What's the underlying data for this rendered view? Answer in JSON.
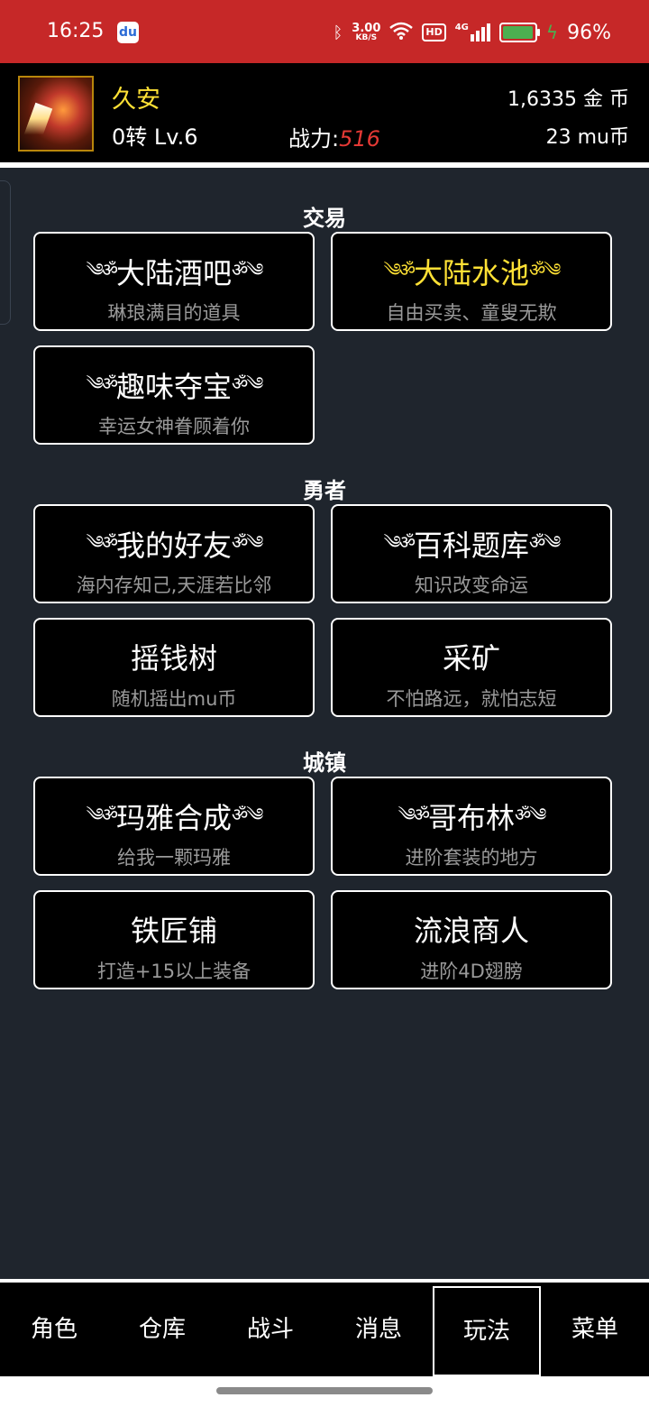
{
  "status_bar": {
    "time": "16:25",
    "app_icon": "baidu-icon",
    "speed_value": "3.00",
    "speed_unit": "KB/S",
    "hd_label": "HD",
    "network_label": "4G",
    "battery_percent": "96%",
    "battery_level": 0.96,
    "icons": [
      "bluetooth-icon",
      "wifi-icon",
      "signal-icon",
      "battery-icon",
      "charging-icon"
    ]
  },
  "header": {
    "player_name": "久安",
    "player_level": "0转 Lv.6",
    "power_label": "战力:",
    "power_value": "516",
    "gold": "1,6335 金 币",
    "mu_coins": "23 mu币",
    "colors": {
      "name": "#ffe135",
      "power_value": "#e53935"
    }
  },
  "ornaments": {
    "left": "༄ॐ",
    "right": "ॐ༄"
  },
  "sections": [
    {
      "title": "交易",
      "cards": [
        {
          "title": "大陆酒吧",
          "subtitle": "琳琅满目的道具",
          "ornate": true,
          "highlight": false
        },
        {
          "title": "大陆水池",
          "subtitle": "自由买卖、童叟无欺",
          "ornate": true,
          "highlight": true
        },
        {
          "title": "趣味夺宝",
          "subtitle": "幸运女神眷顾着你",
          "ornate": true,
          "highlight": false
        }
      ]
    },
    {
      "title": "勇者",
      "cards": [
        {
          "title": "我的好友",
          "subtitle": "海内存知己,天涯若比邻",
          "ornate": true,
          "highlight": false
        },
        {
          "title": "百科题库",
          "subtitle": "知识改变命运",
          "ornate": true,
          "highlight": false
        },
        {
          "title": "摇钱树",
          "subtitle": "随机摇出mu币",
          "ornate": false,
          "highlight": false
        },
        {
          "title": "采矿",
          "subtitle": "不怕路远，就怕志短",
          "ornate": false,
          "highlight": false
        }
      ]
    },
    {
      "title": "城镇",
      "cards": [
        {
          "title": "玛雅合成",
          "subtitle": "给我一颗玛雅",
          "ornate": true,
          "highlight": false
        },
        {
          "title": "哥布林",
          "subtitle": "进阶套装的地方",
          "ornate": true,
          "highlight": false
        },
        {
          "title": "铁匠铺",
          "subtitle": "打造+15以上装备",
          "ornate": false,
          "highlight": false
        },
        {
          "title": "流浪商人",
          "subtitle": "进阶4D翅膀",
          "ornate": false,
          "highlight": false
        }
      ]
    }
  ],
  "bottom_nav": {
    "items": [
      "角色",
      "仓库",
      "战斗",
      "消息",
      "玩法",
      "菜单"
    ],
    "active": "玩法"
  }
}
